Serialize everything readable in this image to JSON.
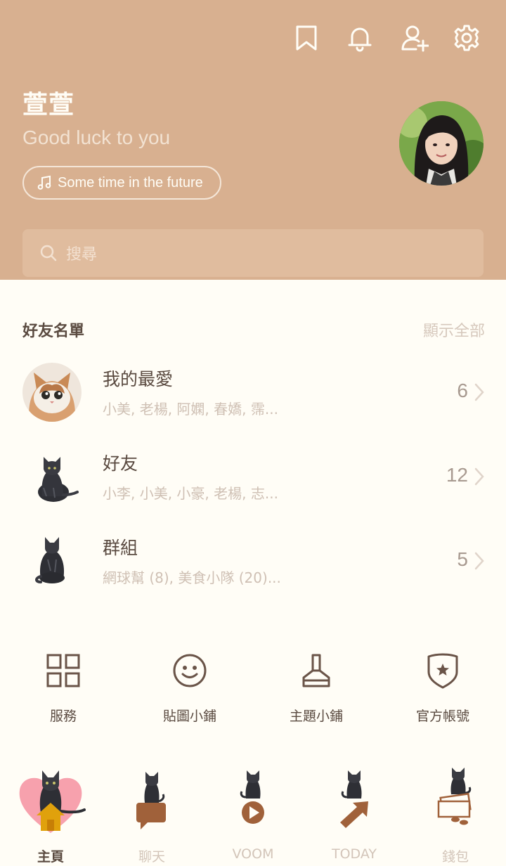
{
  "colors": {
    "header_bg": "#d8b090",
    "page_bg": "#fffdf6",
    "primary_text": "#5a4a40",
    "muted_text": "#cfc0b4",
    "accent": "#a0613a",
    "active_heart": "#f7a1ad"
  },
  "header": {
    "icons": [
      "bookmark-icon",
      "bell-icon",
      "add-friend-icon",
      "gear-icon"
    ],
    "profile_name": "萱萱",
    "status_message": "Good luck to you",
    "music": "Some time in the future",
    "search_placeholder": "搜尋"
  },
  "friends": {
    "title": "好友名單",
    "show_all": "顯示全部",
    "rows": [
      {
        "title": "我的最愛",
        "subtitle": "小美, 老楊, 阿嫻, 春嬌, 霈...",
        "count": "6"
      },
      {
        "title": "好友",
        "subtitle": "小李, 小美, 小豪, 老楊, 志...",
        "count": "12"
      },
      {
        "title": "群組",
        "subtitle": "網球幫 (8), 美食小隊 (20)...",
        "count": "5"
      }
    ]
  },
  "services": [
    {
      "label": "服務",
      "icon": "grid-icon"
    },
    {
      "label": "貼圖小鋪",
      "icon": "smiley-icon"
    },
    {
      "label": "主題小鋪",
      "icon": "brush-icon"
    },
    {
      "label": "官方帳號",
      "icon": "shield-star-icon"
    }
  ],
  "tabs": [
    {
      "label": "主頁",
      "icon": "home-icon",
      "active": true
    },
    {
      "label": "聊天",
      "icon": "chat-icon",
      "active": false
    },
    {
      "label": "VOOM",
      "icon": "play-icon",
      "active": false
    },
    {
      "label": "TODAY",
      "icon": "arrow-icon",
      "active": false
    },
    {
      "label": "錢包",
      "icon": "wallet-icon",
      "active": false
    }
  ]
}
